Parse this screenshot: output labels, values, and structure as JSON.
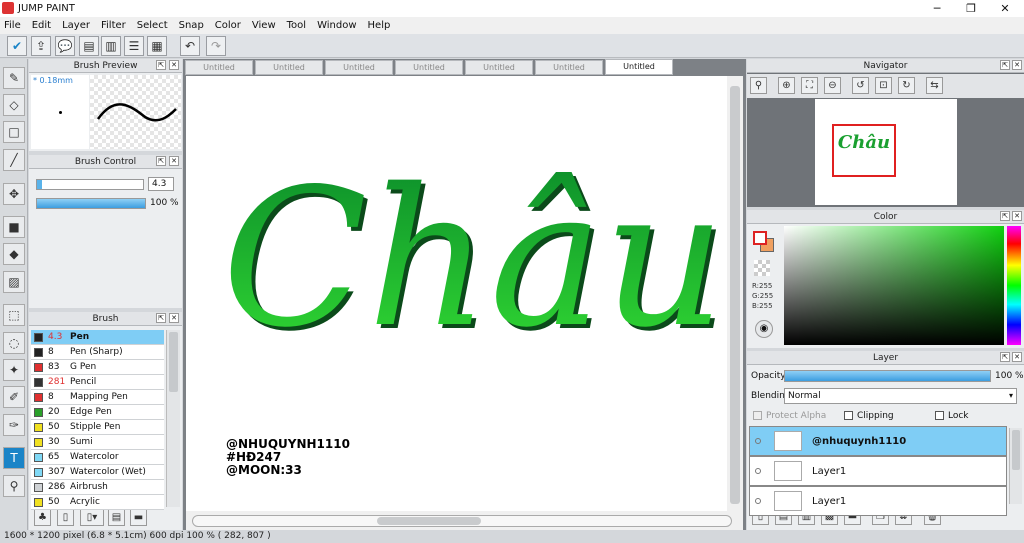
{
  "app": {
    "title": "JUMP PAINT"
  },
  "menu": [
    "File",
    "Edit",
    "Layer",
    "Filter",
    "Select",
    "Snap",
    "Color",
    "View",
    "Tool",
    "Window",
    "Help"
  ],
  "brush_preview": {
    "title": "Brush Preview",
    "size": "* 0.18mm"
  },
  "brush_control": {
    "title": "Brush Control",
    "size_value": "4.3",
    "opacity_value": "100 %",
    "opacity_fraction": 1.0
  },
  "brush": {
    "title": "Brush",
    "items": [
      {
        "size": "4.3",
        "name": "Pen",
        "color": "#222222",
        "size_color": "#e03030",
        "selected": true
      },
      {
        "size": "8",
        "name": "Pen (Sharp)",
        "color": "#222222"
      },
      {
        "size": "83",
        "name": "G Pen",
        "color": "#e03030"
      },
      {
        "size": "281",
        "name": "Pencil",
        "color": "#333333",
        "size_color": "#e03030"
      },
      {
        "size": "8",
        "name": "Mapping Pen",
        "color": "#e03030"
      },
      {
        "size": "20",
        "name": "Edge Pen",
        "color": "#2aa02a"
      },
      {
        "size": "50",
        "name": "Stipple Pen",
        "color": "#f0e020"
      },
      {
        "size": "30",
        "name": "Sumi",
        "color": "#f0e020"
      },
      {
        "size": "65",
        "name": "Watercolor",
        "color": "#7fd8f5"
      },
      {
        "size": "307",
        "name": "Watercolor (Wet)",
        "color": "#7fd8f5"
      },
      {
        "size": "286",
        "name": "Airbrush",
        "color": "#cfd2d5"
      },
      {
        "size": "50",
        "name": "Acrylic",
        "color": "#f0e020"
      }
    ]
  },
  "tabs": [
    "Untitled",
    "Untitled",
    "Untitled",
    "Untitled",
    "Untitled",
    "Untitled",
    "Untitled"
  ],
  "canvas": {
    "art_text": "Châu",
    "credits": [
      "@NHUQUYNH1110",
      "#HĐ247",
      "@MOON:33"
    ]
  },
  "navigator": {
    "title": "Navigator",
    "thumb_text": "Châu"
  },
  "color": {
    "title": "Color",
    "r": "R:255",
    "g": "G:255",
    "b": "B:255",
    "fg": "#ffffff",
    "bg": "#f0a060"
  },
  "layer": {
    "title": "Layer",
    "opacity_label": "Opacity",
    "opacity_value": "100 %",
    "opacity_fraction": 1.0,
    "blending_label": "Blending",
    "blending_value": "Normal",
    "protect_alpha": "Protect Alpha",
    "clipping": "Clipping",
    "lock": "Lock",
    "items": [
      {
        "name": "@nhuquynh1110",
        "selected": true
      },
      {
        "name": "Layer1"
      },
      {
        "name": "Layer1"
      }
    ]
  },
  "status": "1600 * 1200 pixel   (6.8 * 5.1cm)   600 dpi   100 %   ( 282, 807 )"
}
